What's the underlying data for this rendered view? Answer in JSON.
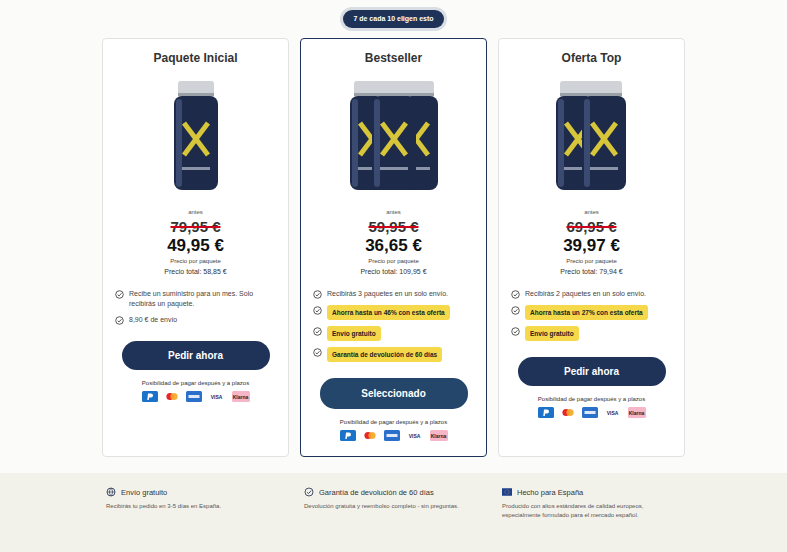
{
  "badge": "7 de cada 10 eligen esto",
  "cards": [
    {
      "title": "Paquete Inicial",
      "bottles": 1,
      "before_label": "antes",
      "old_price": "79,95 €",
      "price": "49,95 €",
      "price_note": "Precio por paquete",
      "total": "Precio total: 58,85 €",
      "features": [
        {
          "text": "Recibe un suministro para un mes. Solo recibirás un paquete.",
          "highlight": false
        },
        {
          "text": "8,90 € de envío",
          "highlight": false
        }
      ],
      "button": "Pedir ahora",
      "selected": false,
      "pay_note": "Posibilidad de pagar después y a plazos"
    },
    {
      "title": "Bestseller",
      "bottles": 3,
      "before_label": "antes",
      "old_price": "59,95 €",
      "price": "36,65 €",
      "price_note": "Precio por paquete",
      "total": "Precio total: 109,95 €",
      "features": [
        {
          "text": "Recibirás 3 paquetes en un solo envío.",
          "highlight": false
        },
        {
          "text": "Ahorra hasta un 46% con esta oferta",
          "highlight": true
        },
        {
          "text": "Envío gratuito",
          "highlight": true
        },
        {
          "text": "Garantía de devolución de 60 días",
          "highlight": true
        }
      ],
      "button": "Seleccionado",
      "selected": true,
      "pay_note": "Posibilidad de pagar después y a plazos"
    },
    {
      "title": "Oferta Top",
      "bottles": 2,
      "before_label": "antes",
      "old_price": "69,95 €",
      "price": "39,97 €",
      "price_note": "Precio por paquete",
      "total": "Precio total: 79,94 €",
      "features": [
        {
          "text": "Recibirás 2 paquetes en un solo envío.",
          "highlight": false
        },
        {
          "text": "Ahorra hasta un 27% con esta oferta",
          "highlight": true
        },
        {
          "text": "Envío gratuito",
          "highlight": true
        }
      ],
      "button": "Pedir ahora",
      "selected": false,
      "pay_note": "Posibilidad de pagar después y a plazos"
    }
  ],
  "payment_methods": [
    {
      "kind": "paypal",
      "label": ""
    },
    {
      "kind": "mastercard",
      "label": ""
    },
    {
      "kind": "amex",
      "label": ""
    },
    {
      "kind": "visa",
      "label": "VISA"
    },
    {
      "kind": "klarna",
      "label": "Klarna"
    }
  ],
  "benefits": [
    {
      "kind": "shipping",
      "title": "Envío gratuito",
      "text": "Recibirás tu pedido en 3-5 días en España."
    },
    {
      "kind": "guarantee",
      "title": "Garantía de devolución de 60 días",
      "text": "Devolución gratuita y reembolso completo - sin preguntas."
    },
    {
      "kind": "origin",
      "title": "Hecho para España",
      "text": "Producido con altos estándares de calidad europeos, especialmente formulado para el mercado español."
    }
  ]
}
